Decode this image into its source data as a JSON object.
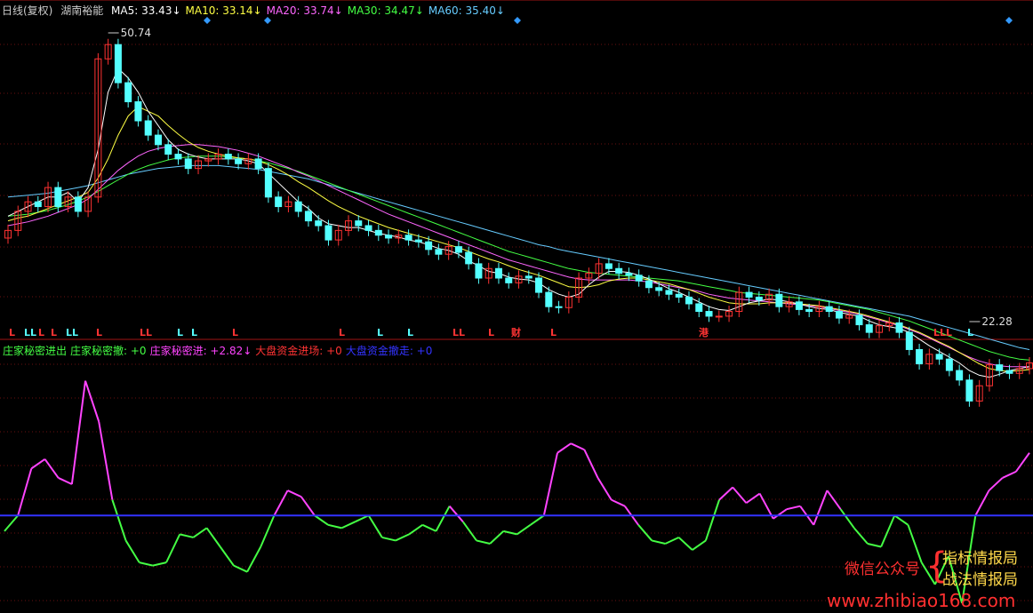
{
  "header": {
    "period": "日线(复权)",
    "stock_name": "湖南裕能",
    "ma": [
      {
        "label": "MA5: 33.43",
        "arrow": "↓",
        "color": "#ffffff"
      },
      {
        "label": "MA10: 33.14",
        "arrow": "↓",
        "color": "#ffff44"
      },
      {
        "label": "MA20: 33.74",
        "arrow": "↓",
        "color": "#ff66ff"
      },
      {
        "label": "MA30: 34.47",
        "arrow": "↓",
        "color": "#44ff44"
      },
      {
        "label": "MA60: 35.40",
        "arrow": "↓",
        "color": "#66ccff"
      }
    ]
  },
  "indicator_header": [
    {
      "label": "庄家秘密进出",
      "color": "#44ff44"
    },
    {
      "label": "庄家秘密撤: +0",
      "color": "#44ff44"
    },
    {
      "label": "庄家秘密进: +2.82↓",
      "color": "#ff44ff"
    },
    {
      "label": "大盘资金进场: +0",
      "color": "#ff3333"
    },
    {
      "label": "大盘资金撤走: +0",
      "color": "#3333ff"
    }
  ],
  "price_markers": {
    "high": "50.74",
    "low": "22.28"
  },
  "markers_text": [
    "L",
    "LL",
    "L",
    "L",
    "LL",
    "L",
    "LL",
    "L",
    "L",
    "L",
    "L",
    "L",
    "L",
    "LL",
    "L",
    "财",
    "L",
    "港",
    "LLL",
    "L"
  ],
  "watermark": {
    "wechat": "微信公众号",
    "line1": "指标情报局",
    "line2": "战法情报局",
    "url": "www.zhibiao168.com"
  },
  "colors": {
    "up": "#ff3232",
    "down": "#54ffff",
    "magenta": "#ff44ff",
    "green": "#44ff44",
    "blue": "#3333ff"
  },
  "chart_data": [
    {
      "type": "candlestick",
      "title": "湖南裕能",
      "ylim": [
        20,
        53
      ],
      "close": [
        30.5,
        32.5,
        33.5,
        33,
        35,
        33,
        34,
        32.5,
        34,
        48.5,
        50,
        46,
        44,
        42,
        40.5,
        39.5,
        38.5,
        38,
        37,
        37.8,
        38,
        38.5,
        38,
        37.5,
        38,
        37,
        34,
        33,
        33.5,
        32.5,
        31.5,
        31,
        29.5,
        30.5,
        31.5,
        31,
        30.5,
        30,
        29.7,
        30,
        29.5,
        29.3,
        28.5,
        28,
        28.8,
        28.2,
        27,
        25.5,
        26.5,
        25.5,
        25,
        25.7,
        25.5,
        24,
        22.5,
        22.4,
        23.5,
        25.5,
        26,
        27,
        26.5,
        26,
        25.8,
        25.2,
        24.5,
        24.2,
        23.8,
        23.5,
        22.8,
        22,
        21.5,
        21.5,
        22,
        24,
        23.5,
        23.2,
        23.8,
        22.5,
        23,
        22.2,
        22,
        22.5,
        22,
        21.3,
        21.6,
        20.6,
        19.8,
        20.5,
        20.8,
        19.8,
        18,
        16.5,
        17.5,
        17,
        15.8,
        14.8,
        12.6,
        14.2,
        16.4,
        15.8,
        15.5,
        16,
        16.6
      ],
      "ma5": [
        32,
        32.5,
        33,
        33.5,
        34,
        34,
        34.5,
        33.5,
        35,
        39,
        45,
        47.5,
        46.5,
        45,
        43,
        41.5,
        40,
        39,
        38.5,
        38.2,
        38,
        38,
        38,
        38,
        37.8,
        37.5,
        36.5,
        35.5,
        34.5,
        33.5,
        32.8,
        31.8,
        31.2,
        31,
        30.8,
        30.8,
        30.5,
        30.2,
        30,
        29.8,
        29.5,
        29.3,
        29,
        28.6,
        28.4,
        28,
        27.3,
        26.8,
        26.2,
        26,
        25.6,
        25.4,
        25.3,
        25,
        24.3,
        23.8,
        23.5,
        23.8,
        24.8,
        25.6,
        26.2,
        26.2,
        26.1,
        25.8,
        25.4,
        24.9,
        24.4,
        24,
        23.5,
        23,
        22.5,
        22.2,
        22.1,
        22.5,
        22.9,
        23.1,
        23.3,
        23.2,
        23,
        22.8,
        22.5,
        22.3,
        22.2,
        21.9,
        21.7,
        21.5,
        21,
        20.6,
        20.4,
        20.2,
        19.8,
        19.1,
        18.4,
        17.8,
        17.2,
        16.6,
        15.8,
        15.3,
        15.1,
        15.4,
        15.8,
        16,
        16.2
      ],
      "ma10": [
        31.5,
        31.8,
        32,
        32.4,
        32.8,
        33.2,
        33.6,
        34,
        34.5,
        36,
        38,
        40.5,
        42.5,
        43.5,
        43,
        42.5,
        41.5,
        40.6,
        39.8,
        39.2,
        38.8,
        38.5,
        38.3,
        38.1,
        38,
        37.8,
        37.4,
        36.9,
        36.3,
        35.6,
        35,
        34.3,
        33.6,
        33,
        32.5,
        32,
        31.6,
        31.2,
        30.8,
        30.5,
        30.2,
        29.9,
        29.6,
        29.3,
        29,
        28.7,
        28.3,
        27.9,
        27.5,
        27.2,
        26.8,
        26.4,
        26.1,
        25.8,
        25.4,
        25,
        24.6,
        24.5,
        24.6,
        24.8,
        25.2,
        25.4,
        25.5,
        25.5,
        25.3,
        25.1,
        24.9,
        24.6,
        24.3,
        23.9,
        23.5,
        23.2,
        22.9,
        22.8,
        22.8,
        22.8,
        22.9,
        22.9,
        22.9,
        22.8,
        22.7,
        22.6,
        22.4,
        22.2,
        22,
        21.8,
        21.5,
        21.2,
        20.9,
        20.6,
        20.2,
        19.8,
        19.3,
        18.8,
        18.3,
        17.7,
        17.1,
        16.5,
        16,
        15.8,
        15.7,
        15.8,
        15.9
      ],
      "ma20": [
        31,
        31.2,
        31.4,
        31.7,
        32,
        32.4,
        32.8,
        33.2,
        33.8,
        34.8,
        35.8,
        36.8,
        37.6,
        38.3,
        38.8,
        39.1,
        39.3,
        39.4,
        39.5,
        39.5,
        39.4,
        39.3,
        39.1,
        38.9,
        38.6,
        38.3,
        37.9,
        37.5,
        37.1,
        36.6,
        36.2,
        35.7,
        35.2,
        34.7,
        34.2,
        33.7,
        33.2,
        32.7,
        32.2,
        31.8,
        31.4,
        31,
        30.6,
        30.2,
        29.8,
        29.4,
        29,
        28.6,
        28.2,
        27.8,
        27.4,
        27.1,
        26.8,
        26.5,
        26.2,
        25.9,
        25.6,
        25.4,
        25.3,
        25.3,
        25.3,
        25.3,
        25.3,
        25.2,
        25.1,
        24.9,
        24.7,
        24.5,
        24.3,
        24.1,
        23.8,
        23.6,
        23.4,
        23.3,
        23.2,
        23.1,
        23,
        22.9,
        22.8,
        22.7,
        22.6,
        22.5,
        22.3,
        22.1,
        21.9,
        21.7,
        21.4,
        21.1,
        20.8,
        20.5,
        20.1,
        19.7,
        19.2,
        18.7,
        18.2,
        17.7,
        17.2,
        16.8,
        16.5,
        16.3,
        16.2,
        16.2,
        16.2
      ],
      "ma30": [
        32,
        32.1,
        32.2,
        32.4,
        32.6,
        32.9,
        33.2,
        33.6,
        34,
        34.6,
        35.2,
        35.8,
        36.4,
        36.9,
        37.3,
        37.6,
        37.9,
        38.1,
        38.2,
        38.3,
        38.3,
        38.3,
        38.2,
        38.1,
        38,
        37.8,
        37.6,
        37.3,
        37,
        36.7,
        36.3,
        35.9,
        35.5,
        35.1,
        34.7,
        34.3,
        33.9,
        33.5,
        33.1,
        32.7,
        32.3,
        31.9,
        31.5,
        31.1,
        30.7,
        30.3,
        29.9,
        29.5,
        29.1,
        28.7,
        28.3,
        28,
        27.7,
        27.4,
        27.1,
        26.8,
        26.5,
        26.3,
        26.1,
        26,
        25.9,
        25.8,
        25.7,
        25.6,
        25.5,
        25.4,
        25.3,
        25.2,
        25,
        24.8,
        24.6,
        24.4,
        24.2,
        24,
        23.9,
        23.8,
        23.7,
        23.6,
        23.5,
        23.4,
        23.3,
        23.2,
        23,
        22.8,
        22.6,
        22.4,
        22.2,
        21.9,
        21.6,
        21.3,
        21,
        20.6,
        20.2,
        19.8,
        19.4,
        19,
        18.6,
        18.2,
        17.8,
        17.5,
        17.2,
        17,
        16.9
      ],
      "ma60": [
        34,
        34.1,
        34.2,
        34.3,
        34.4,
        34.6,
        34.8,
        35,
        35.2,
        35.5,
        35.8,
        36.1,
        36.4,
        36.6,
        36.8,
        37,
        37.1,
        37.2,
        37.3,
        37.3,
        37.3,
        37.3,
        37.2,
        37.1,
        37,
        36.9,
        36.7,
        36.5,
        36.3,
        36.1,
        35.9,
        35.6,
        35.3,
        35,
        34.7,
        34.4,
        34.1,
        33.8,
        33.5,
        33.2,
        32.9,
        32.6,
        32.3,
        32,
        31.7,
        31.4,
        31.1,
        30.8,
        30.5,
        30.2,
        29.9,
        29.6,
        29.3,
        29,
        28.8,
        28.5,
        28.3,
        28.1,
        27.9,
        27.7,
        27.5,
        27.3,
        27.1,
        26.9,
        26.7,
        26.5,
        26.3,
        26.1,
        25.9,
        25.7,
        25.5,
        25.3,
        25.1,
        24.9,
        24.7,
        24.5,
        24.3,
        24.1,
        23.9,
        23.7,
        23.5,
        23.3,
        23.1,
        22.9,
        22.7,
        22.5,
        22.3,
        22.1,
        21.9,
        21.7,
        21.5,
        21.2,
        20.9,
        20.6,
        20.3,
        20,
        19.7,
        19.4,
        19.1,
        18.8,
        18.5,
        18.2,
        18
      ]
    },
    {
      "type": "line",
      "title": "庄家秘密进出",
      "ylim": [
        -3,
        5
      ],
      "baseline": 0,
      "series": [
        {
          "name": "庄家秘密进出",
          "values": [
            -0.5,
            0,
            1.5,
            1.8,
            1.2,
            1,
            4.3,
            3,
            0.5,
            -0.8,
            -1.5,
            -1.6,
            -1.5,
            -0.6,
            -0.7,
            -0.4,
            -1,
            -1.6,
            -1.8,
            -1,
            0,
            0.8,
            0.6,
            0,
            -0.3,
            -0.4,
            -0.2,
            0,
            -0.7,
            -0.8,
            -0.6,
            -0.3,
            -0.5,
            0.3,
            -0.2,
            -0.8,
            -0.9,
            -0.5,
            -0.6,
            -0.3,
            0,
            2,
            2.3,
            2.1,
            1.2,
            0.5,
            0.3,
            -0.3,
            -0.8,
            -0.9,
            -0.7,
            -1.1,
            -0.8,
            0.5,
            0.9,
            0.4,
            0.7,
            -0.1,
            0.2,
            0.3,
            -0.3,
            0.8,
            0.2,
            -0.4,
            -0.9,
            -1,
            0,
            -0.3,
            -1.5,
            -2.2,
            -1.3,
            -2.8,
            0,
            0.8,
            1.2,
            1.4,
            2
          ]
        }
      ]
    }
  ]
}
